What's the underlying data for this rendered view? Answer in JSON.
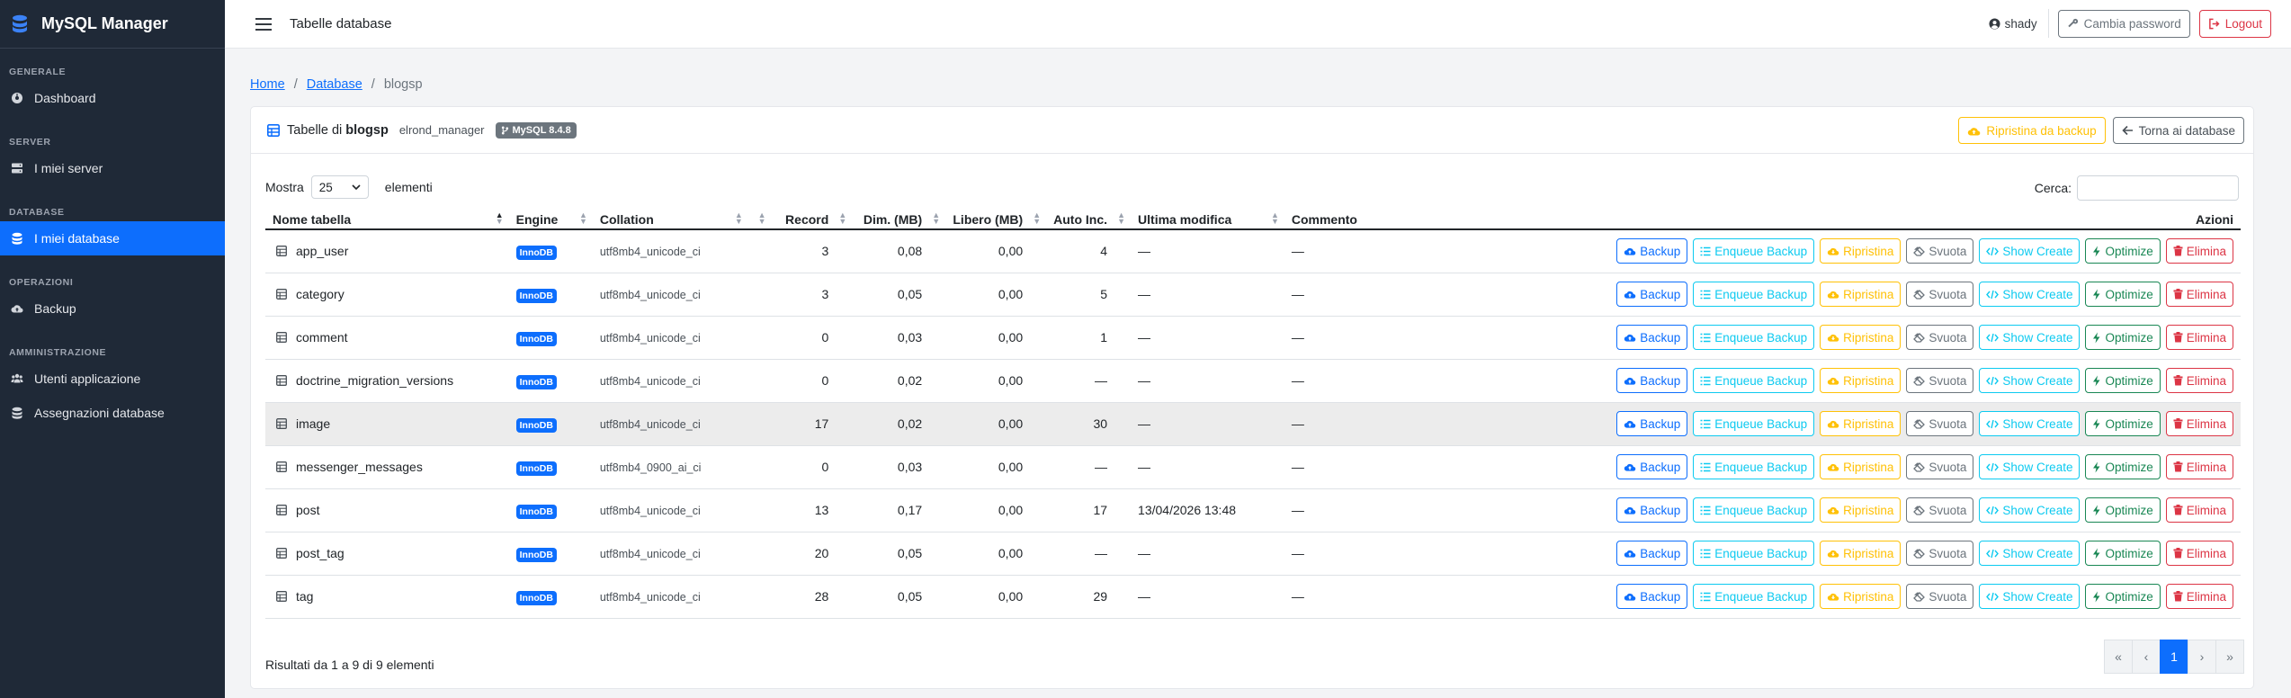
{
  "app": {
    "brand": "MySQL Manager",
    "page_title": "Tabelle database"
  },
  "sidebar": {
    "sections": [
      {
        "label": "GENERALE",
        "items": [
          {
            "label": "Dashboard",
            "icon": "gauge-icon",
            "active": false
          }
        ]
      },
      {
        "label": "SERVER",
        "items": [
          {
            "label": "I miei server",
            "icon": "server-icon",
            "active": false
          }
        ]
      },
      {
        "label": "DATABASE",
        "items": [
          {
            "label": "I miei database",
            "icon": "database-icon",
            "active": true
          }
        ]
      },
      {
        "label": "OPERAZIONI",
        "items": [
          {
            "label": "Backup",
            "icon": "cloud-upload-icon",
            "active": false
          }
        ]
      },
      {
        "label": "AMMINISTRAZIONE",
        "items": [
          {
            "label": "Utenti applicazione",
            "icon": "users-icon",
            "active": false
          },
          {
            "label": "Assegnazioni database",
            "icon": "database-icon",
            "active": false
          }
        ]
      }
    ]
  },
  "topbar": {
    "user": "shady",
    "change_password": "Cambia password",
    "logout": "Logout"
  },
  "breadcrumb": {
    "home": "Home",
    "database": "Database",
    "current": "blogsp"
  },
  "card": {
    "title_prefix": "Tabelle di",
    "db_name": "blogsp",
    "user": "elrond_manager",
    "version_badge": "MySQL 8.4.8",
    "restore_button": "Ripristina da backup",
    "back_button": "Torna ai database"
  },
  "controls": {
    "show_label": "Mostra",
    "page_size": "25",
    "entries_label": "elementi",
    "search_label": "Cerca:"
  },
  "table": {
    "columns": [
      "Nome tabella",
      "Engine",
      "Collation",
      "",
      "Record",
      "Dim. (MB)",
      "Libero (MB)",
      "Auto Inc.",
      "Ultima modifica",
      "Commento",
      "Azioni"
    ],
    "actions": [
      "Backup",
      "Enqueue Backup",
      "Ripristina",
      "Svuota",
      "Show Create",
      "Optimize",
      "Elimina"
    ],
    "rows": [
      {
        "name": "app_user",
        "engine": "InnoDB",
        "collation": "utf8mb4_unicode_ci",
        "records": "3",
        "size": "0,08",
        "free": "0,00",
        "auto_inc": "4",
        "modified": "—",
        "comment": "—"
      },
      {
        "name": "category",
        "engine": "InnoDB",
        "collation": "utf8mb4_unicode_ci",
        "records": "3",
        "size": "0,05",
        "free": "0,00",
        "auto_inc": "5",
        "modified": "—",
        "comment": "—"
      },
      {
        "name": "comment",
        "engine": "InnoDB",
        "collation": "utf8mb4_unicode_ci",
        "records": "0",
        "size": "0,03",
        "free": "0,00",
        "auto_inc": "1",
        "modified": "—",
        "comment": "—"
      },
      {
        "name": "doctrine_migration_versions",
        "engine": "InnoDB",
        "collation": "utf8mb4_unicode_ci",
        "records": "0",
        "size": "0,02",
        "free": "0,00",
        "auto_inc": "—",
        "modified": "—",
        "comment": "—"
      },
      {
        "name": "image",
        "engine": "InnoDB",
        "collation": "utf8mb4_unicode_ci",
        "records": "17",
        "size": "0,02",
        "free": "0,00",
        "auto_inc": "30",
        "modified": "—",
        "comment": "—"
      },
      {
        "name": "messenger_messages",
        "engine": "InnoDB",
        "collation": "utf8mb4_0900_ai_ci",
        "records": "0",
        "size": "0,03",
        "free": "0,00",
        "auto_inc": "—",
        "modified": "—",
        "comment": "—"
      },
      {
        "name": "post",
        "engine": "InnoDB",
        "collation": "utf8mb4_unicode_ci",
        "records": "13",
        "size": "0,17",
        "free": "0,00",
        "auto_inc": "17",
        "modified": "13/04/2026 13:48",
        "comment": "—"
      },
      {
        "name": "post_tag",
        "engine": "InnoDB",
        "collation": "utf8mb4_unicode_ci",
        "records": "20",
        "size": "0,05",
        "free": "0,00",
        "auto_inc": "—",
        "modified": "—",
        "comment": "—"
      },
      {
        "name": "tag",
        "engine": "InnoDB",
        "collation": "utf8mb4_unicode_ci",
        "records": "28",
        "size": "0,05",
        "free": "0,00",
        "auto_inc": "29",
        "modified": "—",
        "comment": "—"
      }
    ]
  },
  "footer": {
    "info": "Risultati da 1 a 9 di 9 elementi",
    "pager": [
      "«",
      "‹",
      "1",
      "›",
      "»"
    ],
    "current_page": "1"
  },
  "colors": {
    "sidebar_bg": "#1f2937",
    "accent": "#0d6efd",
    "warning": "#ffc107",
    "info": "#0dcaf0",
    "success": "#198754",
    "danger": "#dc3545",
    "secondary": "#6c757d"
  }
}
